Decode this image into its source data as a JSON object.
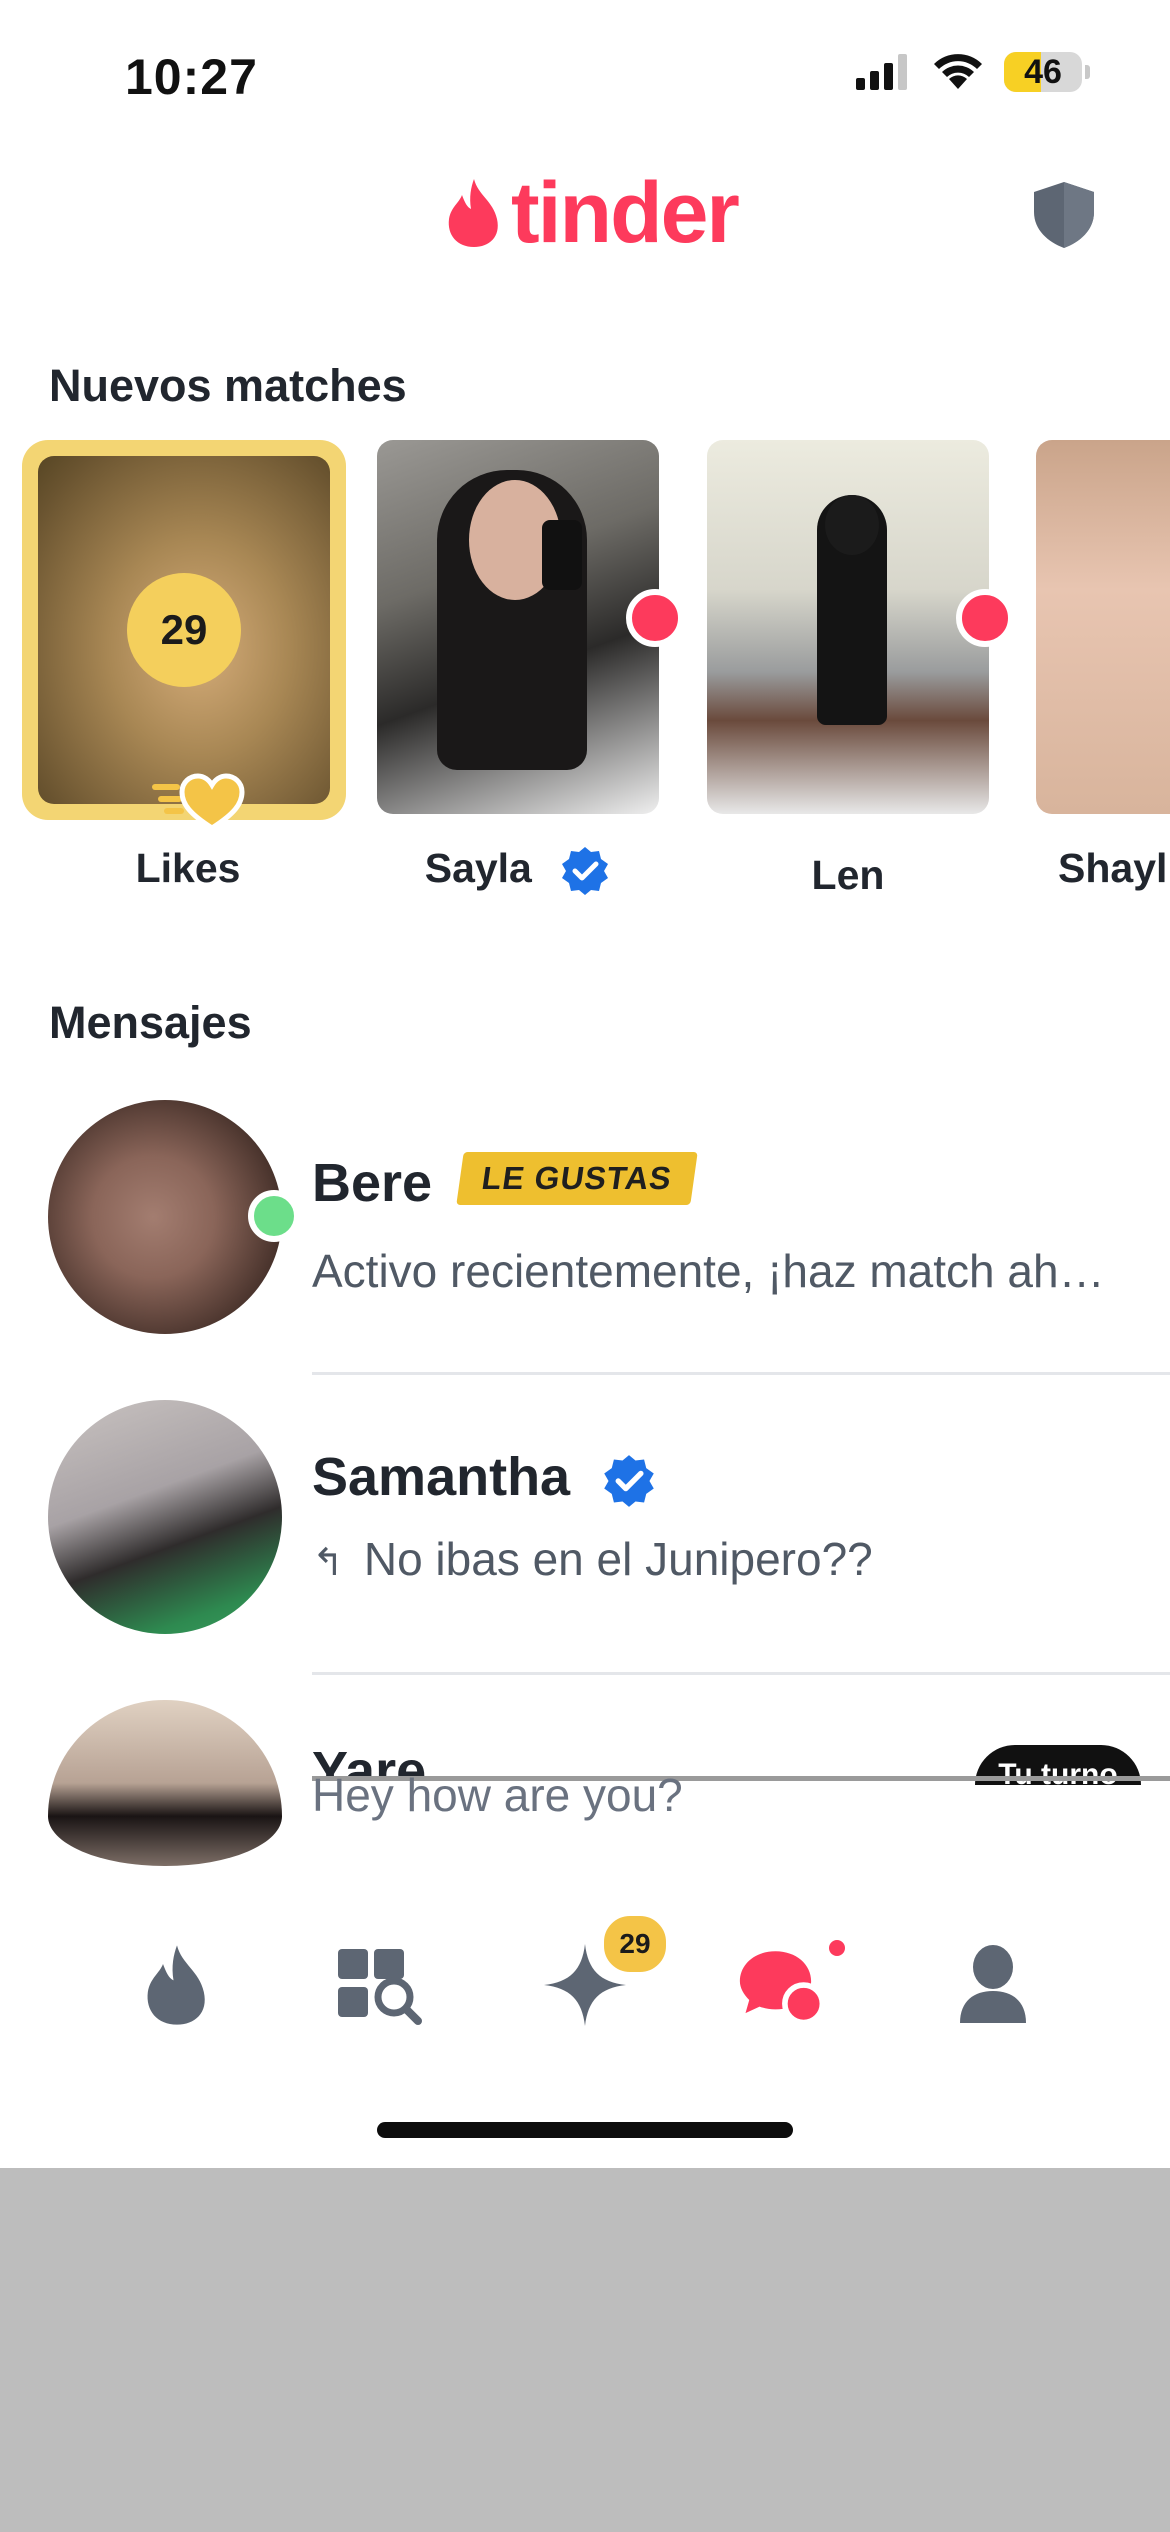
{
  "status_bar": {
    "time": "10:27",
    "battery": "46",
    "battery_level": 0.46
  },
  "header": {
    "logo_text": "tinder",
    "shield_icon": "shield-icon"
  },
  "new_matches": {
    "title": "Nuevos matches",
    "likes": {
      "count": "29",
      "label": "Likes"
    },
    "matches": [
      {
        "name": "Sayla",
        "verified": true,
        "new": true
      },
      {
        "name": "Len",
        "verified": false,
        "new": true
      },
      {
        "name": "Shayl",
        "verified": false,
        "new": false
      }
    ]
  },
  "messages": {
    "title": "Mensajes",
    "items": [
      {
        "name": "Bere",
        "badge": "LE GUSTAS",
        "preview": "Activo recientemente, ¡haz match ah…",
        "online": true
      },
      {
        "name": "Samantha",
        "verified": true,
        "preview": "No ibas en el Junipero??",
        "replied": true
      },
      {
        "name": "Yare",
        "preview": "Hey how are you?",
        "pill": "Tu turno"
      }
    ]
  },
  "tabbar": {
    "items": [
      {
        "name": "tab-home",
        "icon": "flame-icon"
      },
      {
        "name": "tab-explore",
        "icon": "explore-icon"
      },
      {
        "name": "tab-likes",
        "icon": "sparkle-icon",
        "badge": "29"
      },
      {
        "name": "tab-messages",
        "icon": "chat-icon",
        "active": true
      },
      {
        "name": "tab-profile",
        "icon": "profile-icon"
      }
    ]
  },
  "colors": {
    "brand": "#fd3a5c",
    "gold": "#f3d573",
    "text": "#21262e",
    "muted": "#505965",
    "verified": "#1e72e6",
    "online": "#6cde8a"
  }
}
